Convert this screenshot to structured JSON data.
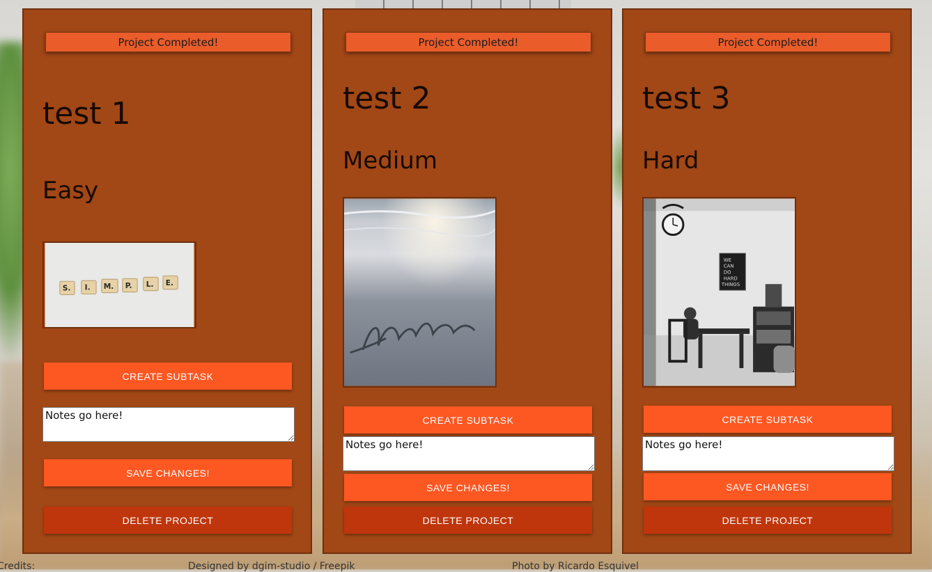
{
  "projects": [
    {
      "completed_label": "Project Completed!",
      "title": "test 1",
      "difficulty": "Easy",
      "image_subject": "scrabble tiles spelling SIMPLE",
      "tile_letters": [
        "S.",
        "I.",
        "M.",
        "P.",
        "L.",
        "E."
      ],
      "create_subtask_label": "Create Subtask",
      "notes_value": "Notes go here!",
      "save_label": "Save Changes!",
      "delete_label": "Delete Project"
    },
    {
      "completed_label": "Project Completed!",
      "title": "test 2",
      "difficulty": "Medium",
      "image_subject": "word Hustle written in beach sand",
      "create_subtask_label": "Create Subtask",
      "notes_value": "Notes go here!",
      "save_label": "Save Changes!",
      "delete_label": "Delete Project"
    },
    {
      "completed_label": "Project Completed!",
      "title": "test 3",
      "difficulty": "Hard",
      "image_subject": "child at desk with clock and sign",
      "sign_lines": [
        "WE",
        "CAN",
        "DO",
        "HARD",
        "THINGS"
      ],
      "create_subtask_label": "Create Subtask",
      "notes_value": "Notes go here!",
      "save_label": "Save Changes!",
      "delete_label": "Delete Project"
    }
  ],
  "footer": {
    "credits_label": "Credits:",
    "designer_credit": "Designed by dgim-studio / Freepik",
    "photo_credit": "Photo by Ricardo Esquivel"
  },
  "colors": {
    "card_bg": "#a24716",
    "button_orange": "#fd5722",
    "button_delete": "#bf360c",
    "completed_button": "#ea5c2a"
  }
}
